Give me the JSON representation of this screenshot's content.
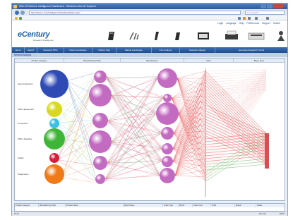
{
  "window": {
    "title": "Web Of Science Intelligence Dashboard - Windows Internet Explorer"
  },
  "browser": {
    "url": "http://www.tc.com/intelligence/dashboard/index.aspx",
    "search_placeholder": "Live Search",
    "status": "Done",
    "zone": "Internet",
    "zoom": "100%"
  },
  "header": {
    "brand": "eCentury",
    "brand_sub": "Research Intelligence",
    "links": [
      "Login",
      "Language",
      "Help",
      "Preferences",
      "Support",
      "Search"
    ]
  },
  "nav": {
    "tabs": [
      "Home",
      "Search",
      "Research KPIs",
      "Patent Landscape",
      "Citation Map",
      "Market Landscape",
      "KOL Analysis",
      "Network Analysis",
      "Emerging Research Trends"
    ]
  },
  "section": {
    "title": "Network Analysis"
  },
  "chart_headers": [
    "Product Category",
    "Manufacturing Plant",
    "Manufacturer",
    "Date",
    "Buyer Zone"
  ],
  "chart_data": {
    "type": "parallel-sets",
    "axes": [
      {
        "name": "Product Category",
        "color": "#2e4ab5"
      },
      {
        "name": "Manufacturing Plant",
        "color": "#c26bc1"
      },
      {
        "name": "Manufacturer",
        "color": "#c26bc1"
      },
      {
        "name": "Date",
        "color": "#d84a4a"
      },
      {
        "name": "Buyer Zone",
        "color": "#e87878"
      }
    ],
    "colors": {
      "category_1": "#2e4ab5",
      "category_2": "#d8d81e",
      "category_3": "#3ac0e8",
      "category_4": "#3fb537",
      "category_5": "#d81e3c",
      "category_6": "#f07a18",
      "node_pink": "#c26bc1",
      "flow_red": "#e43c3c",
      "flow_green": "#51a845"
    },
    "labels": {
      "categories": [
        "Semiconductors",
        "Office Equipment",
        "Computers",
        "Office Supplies",
        "Chairs",
        "Telephones"
      ],
      "buyer_values": [
        "1,095",
        "960"
      ]
    }
  },
  "detail_headers": [
    "Product Category",
    "Manufacturing Plant",
    "Product Name",
    "Buyer Name",
    "Order Type",
    "Month",
    "Order Cost",
    "Profit",
    "Margin",
    "Status"
  ]
}
